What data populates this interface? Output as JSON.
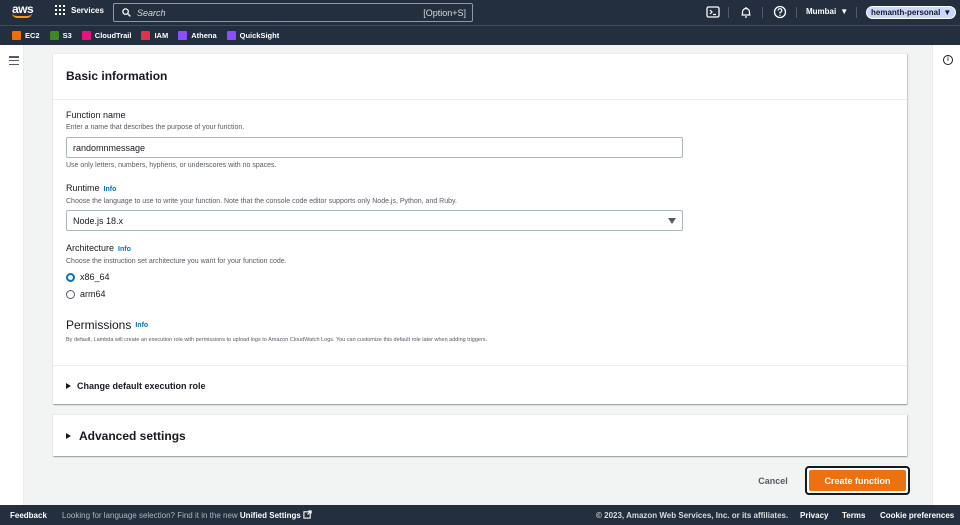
{
  "topnav": {
    "logo": "aws",
    "services_label": "Services",
    "search_placeholder": "Search",
    "search_shortcut": "[Option+S]",
    "region": "Mumbai",
    "account": "hemanth-personal",
    "icons": [
      "cloudshell-icon",
      "notifications-bell-icon",
      "help-icon"
    ]
  },
  "favorites": [
    {
      "label": "EC2",
      "color": "#ed7100"
    },
    {
      "label": "S3",
      "color": "#3f8624"
    },
    {
      "label": "CloudTrail",
      "color": "#e7157b"
    },
    {
      "label": "IAM",
      "color": "#dd344c"
    },
    {
      "label": "Athena",
      "color": "#8c4fff"
    },
    {
      "label": "QuickSight",
      "color": "#8c4fff"
    }
  ],
  "basic": {
    "title": "Basic information",
    "function_name_label": "Function name",
    "function_name_desc": "Enter a name that describes the purpose of your function.",
    "function_name_value": "randomnmessage",
    "function_name_hint": "Use only letters, numbers, hyphens, or underscores with no spaces.",
    "runtime_label": "Runtime",
    "info": "Info",
    "runtime_desc": "Choose the language to use to write your function. Note that the console code editor supports only Node.js, Python, and Ruby.",
    "runtime_value": "Node.js 18.x",
    "arch_label": "Architecture",
    "arch_desc": "Choose the instruction set architecture you want for your function code.",
    "arch_options": [
      "x86_64",
      "arm64"
    ],
    "arch_selected": "x86_64",
    "permissions_label": "Permissions",
    "permissions_desc": "By default, Lambda will create an execution role with permissions to upload logs to Amazon CloudWatch Logs. You can customize this default role later when adding triggers.",
    "exec_role": "Change default execution role"
  },
  "advanced": {
    "title": "Advanced settings"
  },
  "actions": {
    "cancel": "Cancel",
    "create": "Create function"
  },
  "footer": {
    "feedback": "Feedback",
    "lang_text": "Looking for language selection? Find it in the new",
    "lang_link": "Unified Settings",
    "copyright": "© 2023, Amazon Web Services, Inc. or its affiliates.",
    "privacy": "Privacy",
    "terms": "Terms",
    "cookies": "Cookie preferences"
  }
}
